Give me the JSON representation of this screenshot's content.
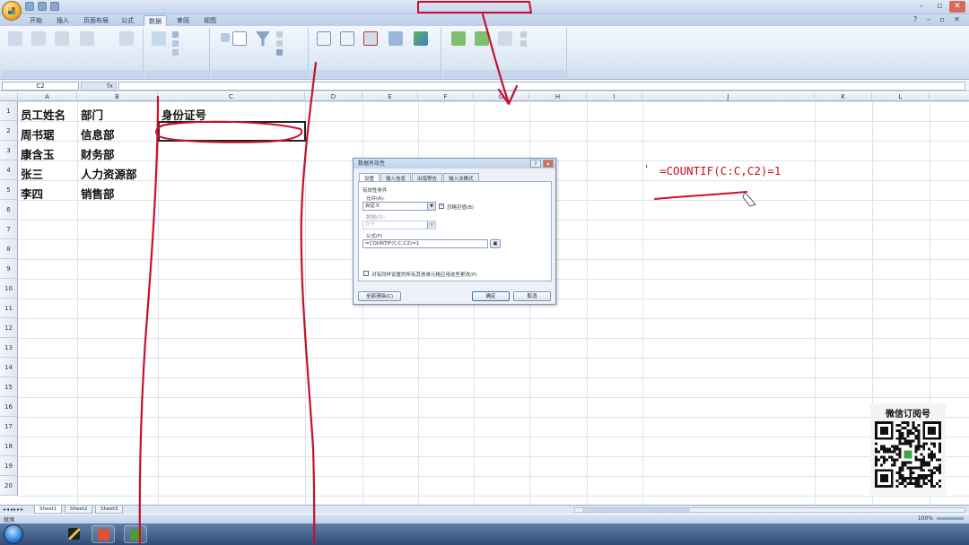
{
  "window": {
    "title": ""
  },
  "tabs": [
    "开始",
    "插入",
    "页面布局",
    "公式",
    "数据",
    "审阅",
    "视图"
  ],
  "active_tab": "数据",
  "formula_bar": {
    "name_box": "C2",
    "fx": "fx",
    "value": ""
  },
  "columns": [
    "A",
    "B",
    "C",
    "D",
    "E",
    "F",
    "G",
    "H",
    "I",
    "J",
    "K",
    "L"
  ],
  "rows": [
    "1",
    "2",
    "3",
    "4",
    "5",
    "6",
    "7",
    "8",
    "9",
    "10",
    "11",
    "12",
    "13",
    "14",
    "15",
    "16",
    "17",
    "18",
    "19",
    "20"
  ],
  "cells": {
    "a1": "员工姓名",
    "b1": "部门",
    "c1": "身份证号",
    "a2": "周书琚",
    "b2": "信息部",
    "a3": "康含玉",
    "b3": "财务部",
    "a4": "张三",
    "b4": "人力资源部",
    "a5": "李四",
    "b5": "销售部"
  },
  "dialog": {
    "title": "数据有效性",
    "tabs": [
      "设置",
      "输入信息",
      "出错警告",
      "输入法模式"
    ],
    "criteria_label": "有效性条件",
    "allow_label": "允许(A):",
    "allow_value": "自定义",
    "ignore_blank": "忽略空值(B)",
    "data_label": "数据(D):",
    "data_value": "介于",
    "formula_label": "公式(F)",
    "formula_value": "=COUNTIF(C:C,C2)=1",
    "apply_all": "对有同样设置的所有其他单元格应用这些更改(P)",
    "clear_btn": "全部清除(C)",
    "ok_btn": "确定",
    "cancel_btn": "取消"
  },
  "sheets": [
    "Sheet1",
    "Sheet2",
    "Sheet3"
  ],
  "status": {
    "ready": "就绪",
    "zoom": "100%"
  },
  "annotation_text": "=COUNTIF(C:C,C2)=1",
  "annotation_tick": "'",
  "qr_title": "微信订阅号",
  "colors": {
    "ink_red": "#c8102e",
    "ribbon_blue": "#dde8f6",
    "annotation_red": "#cc1020"
  }
}
